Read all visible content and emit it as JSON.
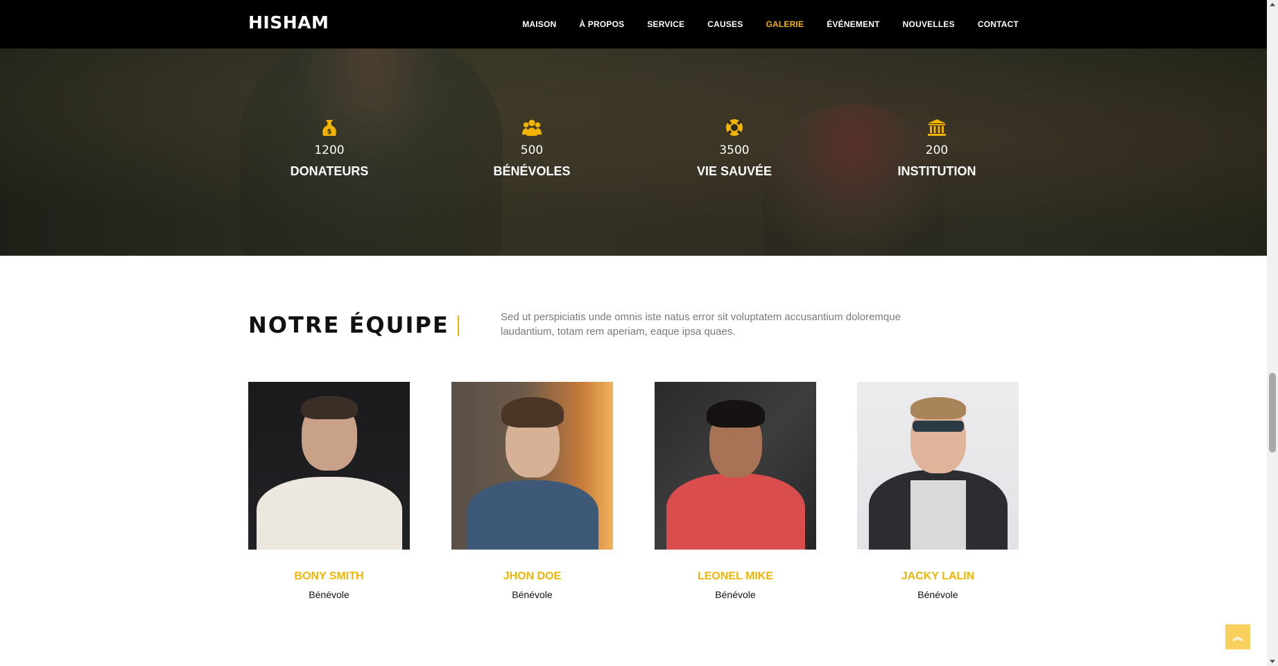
{
  "header": {
    "logo": "HISHAM",
    "nav": [
      {
        "label": "MAISON",
        "active": false
      },
      {
        "label": "À PROPOS",
        "active": false
      },
      {
        "label": "SERVICE",
        "active": false
      },
      {
        "label": "CAUSES",
        "active": false
      },
      {
        "label": "GALERIE",
        "active": true
      },
      {
        "label": "ÉVÉNEMENT",
        "active": false
      },
      {
        "label": "NOUVELLES",
        "active": false
      },
      {
        "label": "CONTACT",
        "active": false
      }
    ]
  },
  "counters": [
    {
      "icon": "money-bag-icon",
      "value": "1200",
      "label": "DONATEURS"
    },
    {
      "icon": "group-icon",
      "value": "500",
      "label": "BÉNÉVOLES"
    },
    {
      "icon": "life-ring-icon",
      "value": "3500",
      "label": "VIE SAUVÉE"
    },
    {
      "icon": "institution-icon",
      "value": "200",
      "label": "INSTITUTION"
    }
  ],
  "team": {
    "title": "NOTRE ÉQUIPE",
    "description": "Sed ut perspiciatis unde omnis iste natus error sit voluptatem accusantium doloremque laudantium, totam rem aperiam, eaque ipsa quaes.",
    "members": [
      {
        "name": "BONY SMITH",
        "role": "Bénévole"
      },
      {
        "name": "JHON DOE",
        "role": "Bénévole"
      },
      {
        "name": "LEONEL MIKE",
        "role": "Bénévole"
      },
      {
        "name": "JACKY LALIN",
        "role": "Bénévole"
      }
    ]
  },
  "back_to_top": {
    "icon": "double-chevron-up-icon",
    "glyph": "︽"
  },
  "colors": {
    "accent": "#f3b400",
    "header_bg": "#000000",
    "back_to_top_bg": "#f9cf5e"
  }
}
